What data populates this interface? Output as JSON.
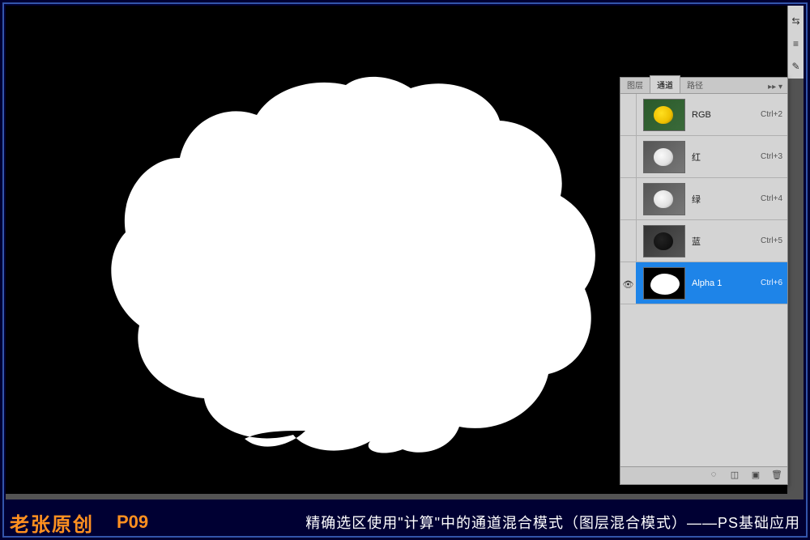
{
  "panel": {
    "tabs": {
      "layers": "图层",
      "channels": "通道",
      "paths": "路径"
    },
    "channels": [
      {
        "name": "RGB",
        "shortcut": "Ctrl+2",
        "thumb": "rgb",
        "visible": false,
        "selected": false
      },
      {
        "name": "红",
        "shortcut": "Ctrl+3",
        "thumb": "gray",
        "visible": false,
        "selected": false
      },
      {
        "name": "绿",
        "shortcut": "Ctrl+4",
        "thumb": "gray",
        "visible": false,
        "selected": false
      },
      {
        "name": "蓝",
        "shortcut": "Ctrl+5",
        "thumb": "dark",
        "visible": false,
        "selected": false
      },
      {
        "name": "Alpha 1",
        "shortcut": "Ctrl+6",
        "thumb": "alpha",
        "visible": true,
        "selected": true
      }
    ]
  },
  "caption": {
    "author": "老张原创",
    "page": "P09",
    "desc": "精确选区使用\"计算\"中的通道混合模式（图层混合模式）——PS基础应用"
  }
}
